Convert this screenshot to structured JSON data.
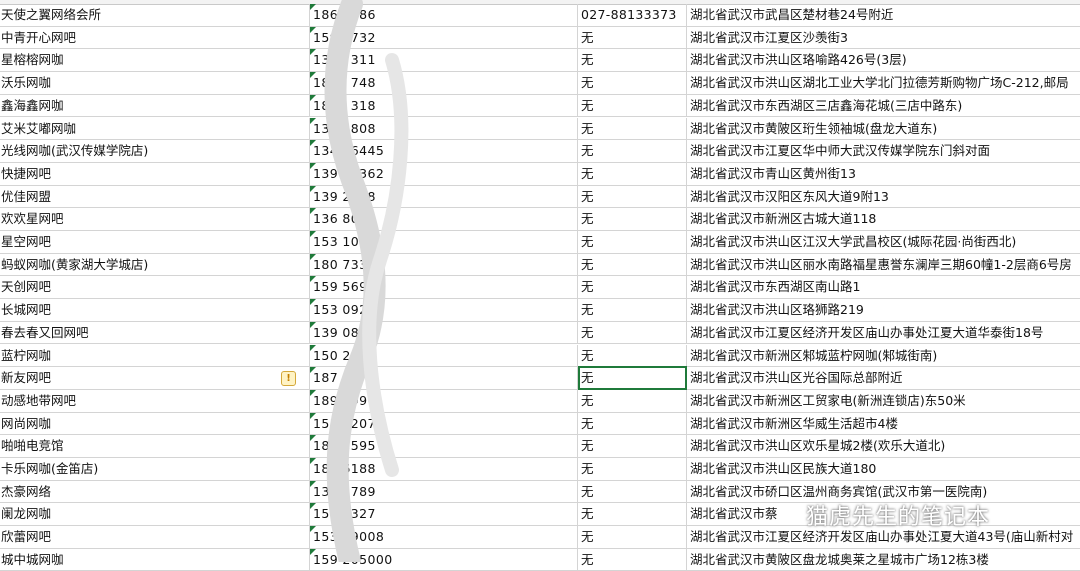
{
  "sheet": {
    "columns": [
      "name",
      "mobile",
      "phone",
      "address"
    ],
    "rows": [
      {
        "name": "天使之翼网络会所",
        "mobile": "1863   586",
        "phone": "027-88133373",
        "address": "湖北省武汉市武昌区楚材巷24号附近"
      },
      {
        "name": "中青开心网吧",
        "mobile": "1592   732",
        "phone": "无",
        "address": "湖北省武汉市江夏区沙羡街3"
      },
      {
        "name": "星榕榕网咖",
        "mobile": "1351   311",
        "phone": "无",
        "address": "湖北省武汉市洪山区珞喻路426号(3层)"
      },
      {
        "name": "沃乐网咖",
        "mobile": "1898   748",
        "phone": "无",
        "address": "湖北省武汉市洪山区湖北工业大学北门拉德芳斯购物广场C-212,邮局"
      },
      {
        "name": "鑫海鑫网咖",
        "mobile": "1898   318",
        "phone": "无",
        "address": "湖北省武汉市东西湖区三店鑫海花城(三店中路东)"
      },
      {
        "name": "艾米艾嘟网咖",
        "mobile": "1354   808",
        "phone": "无",
        "address": "湖北省武汉市黄陂区珩生领袖城(盘龙大道东)"
      },
      {
        "name": "光线网咖(武汉传媒学院店)",
        "mobile": "1341   6445",
        "phone": "无",
        "address": "湖北省武汉市江夏区华中师大武汉传媒学院东门斜对面"
      },
      {
        "name": "快捷网吧",
        "mobile": "139   94362",
        "phone": "无",
        "address": "湖北省武汉市青山区黄州街13"
      },
      {
        "name": "优佳网盟",
        "mobile": "139   2148",
        "phone": "无",
        "address": "湖北省武汉市汉阳区东风大道9附13"
      },
      {
        "name": "欢欢星网吧",
        "mobile": "136   8070",
        "phone": "无",
        "address": "湖北省武汉市新洲区古城大道118"
      },
      {
        "name": "星空网吧",
        "mobile": "153   1060",
        "phone": "无",
        "address": "湖北省武汉市洪山区江汉大学武昌校区(城际花园·尚街西北)"
      },
      {
        "name": "蚂蚁网咖(黄家湖大学城店)",
        "mobile": "180   7332",
        "phone": "无",
        "address": "湖北省武汉市洪山区丽水南路福星惠誉东澜岸三期60幢1-2层商6号房"
      },
      {
        "name": "天创网吧",
        "mobile": "159   5690",
        "phone": "无",
        "address": "湖北省武汉市东西湖区南山路1"
      },
      {
        "name": "长城网吧",
        "mobile": "153   0928",
        "phone": "无",
        "address": "湖北省武汉市洪山区珞狮路219"
      },
      {
        "name": "春去春又回网吧",
        "mobile": "139   0894",
        "phone": "无",
        "address": "湖北省武汉市江夏区经济开发区庙山办事处江夏大道华泰街18号"
      },
      {
        "name": "蓝柠网咖",
        "mobile": "150   2606",
        "phone": "无",
        "address": "湖北省武汉市新洲区邾城蓝柠网咖(邾城街南)"
      },
      {
        "name": "新友网吧",
        "mobile": "187   1875",
        "phone": "无",
        "address": "湖北省武汉市洪山区光谷国际总部附近"
      },
      {
        "name": "动感地带网吧",
        "mobile": "189   2990",
        "phone": "无",
        "address": "湖北省武汉市新洲区工贸家电(新洲连锁店)东50米"
      },
      {
        "name": "网尚网咖",
        "mobile": "153   2207",
        "phone": "无",
        "address": "湖北省武汉市新洲区华威生活超市4楼"
      },
      {
        "name": "啪啪电竞馆",
        "mobile": "188   8595",
        "phone": "无",
        "address": "湖北省武汉市洪山区欢乐星城2楼(欢乐大道北)"
      },
      {
        "name": "卡乐网咖(金笛店)",
        "mobile": "180   6188",
        "phone": "无",
        "address": "湖北省武汉市洪山区民族大道180"
      },
      {
        "name": "杰豪网络",
        "mobile": "139   5789",
        "phone": "无",
        "address": "湖北省武汉市硚口区温州商务宾馆(武汉市第一医院南)"
      },
      {
        "name": "阑龙网咖",
        "mobile": "153   3327",
        "phone": "无",
        "address": "湖北省武汉市蔡"
      },
      {
        "name": "欣蕾网吧",
        "mobile": "1534   9008",
        "phone": "无",
        "address": "湖北省武汉市江夏区经济开发区庙山办事处江夏大道43号(庙山新村对"
      },
      {
        "name": "城中城网咖",
        "mobile": "159   205000",
        "phone": "无",
        "address": "湖北省武汉市黄陂区盘龙城奥莱之星城市广场12栋3楼"
      }
    ]
  },
  "selected_row": 16,
  "warning_row": 16,
  "icons": {
    "warning": "warning-icon",
    "watermark": "wechat-icon"
  },
  "watermark_text": "猫虎先生的笔记本",
  "colors": {
    "grid": "#d4d4d4",
    "selection": "#1f7a3a",
    "text": "#111111"
  }
}
